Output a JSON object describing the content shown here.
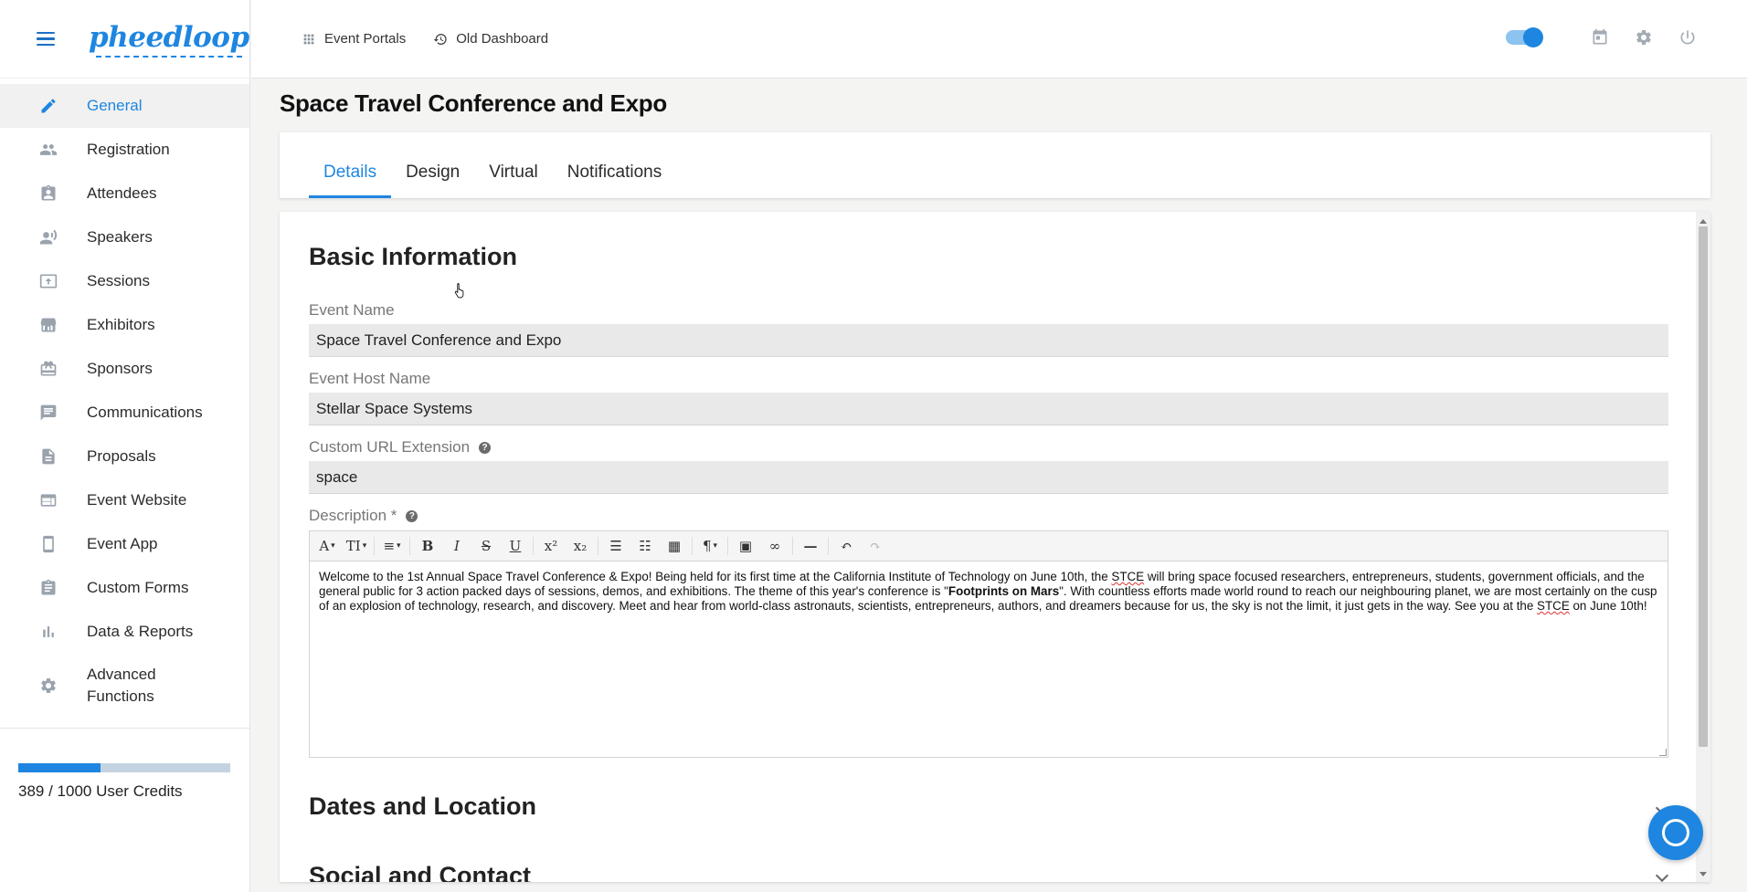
{
  "brand": {
    "logo_text": "pheedloop",
    "accent": "#1e86e0"
  },
  "sidebar": {
    "items": [
      {
        "label": "General",
        "icon": "pencil-icon",
        "active": true
      },
      {
        "label": "Registration",
        "icon": "people-icon"
      },
      {
        "label": "Attendees",
        "icon": "badge-icon"
      },
      {
        "label": "Speakers",
        "icon": "speaker-icon"
      },
      {
        "label": "Sessions",
        "icon": "presentation-icon"
      },
      {
        "label": "Exhibitors",
        "icon": "storefront-icon"
      },
      {
        "label": "Sponsors",
        "icon": "gift-icon"
      },
      {
        "label": "Communications",
        "icon": "chat-icon"
      },
      {
        "label": "Proposals",
        "icon": "document-icon"
      },
      {
        "label": "Event Website",
        "icon": "browser-icon"
      },
      {
        "label": "Event App",
        "icon": "phone-icon"
      },
      {
        "label": "Custom Forms",
        "icon": "clipboard-icon"
      },
      {
        "label": "Data & Reports",
        "icon": "bar-chart-icon"
      },
      {
        "label": "Advanced\nFunctions",
        "icon": "gear-icon"
      }
    ],
    "credits": {
      "used": 389,
      "total": 1000,
      "fraction": 0.389,
      "text": "389 / 1000 User Credits"
    }
  },
  "topbar": {
    "portals_label": "Event Portals",
    "old_dashboard_label": "Old Dashboard"
  },
  "page": {
    "title": "Space Travel Conference and Expo"
  },
  "tabs": [
    {
      "label": "Details",
      "active": true
    },
    {
      "label": "Design"
    },
    {
      "label": "Virtual"
    },
    {
      "label": "Notifications"
    }
  ],
  "basic_info": {
    "title": "Basic Information",
    "event_name_label": "Event Name",
    "event_name_value": "Space Travel Conference and Expo",
    "host_label": "Event Host Name",
    "host_value": "Stellar Space Systems",
    "url_label": "Custom URL Extension",
    "url_value": "space",
    "description_label": "Description *",
    "description": {
      "part1": "Welcome to the 1st Annual Space Travel Conference & Expo! Being held for its first time at the California Institute of Technology on June 10th, the ",
      "stce": "STCE",
      "part2": " will bring space focused researchers, entrepreneurs, students, government officials, and the general public for 3 action packed days of sessions, demos, and exhibitions. The theme of this year's conference is \"",
      "bold": "Footprints on Mars",
      "part3": "\". With countless efforts made world round to reach our neighbouring planet, we are most certainly on the cusp of an explosion of technology, research, and discovery. Meet and hear from world-class astronauts, scientists, entrepreneurs, authors, and dreamers because for us, the sky is not the limit, it just gets in the way. See you at the ",
      "part4": " on June 10th!"
    }
  },
  "sections": {
    "dates_location": "Dates and Location",
    "social_contact": "Social and Contact"
  },
  "help_icon_glyph": "?"
}
